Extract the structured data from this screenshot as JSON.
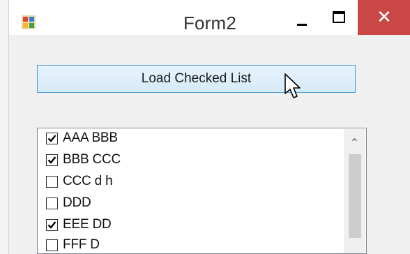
{
  "window": {
    "title": "Form2",
    "close_glyph": "✕"
  },
  "toolbar": {
    "load_label": "Load Checked List"
  },
  "list": {
    "items": [
      {
        "label": "AAA BBB",
        "checked": true
      },
      {
        "label": "BBB CCC",
        "checked": true
      },
      {
        "label": "CCC d h",
        "checked": false
      },
      {
        "label": "DDD",
        "checked": false
      },
      {
        "label": "EEE DD",
        "checked": true
      },
      {
        "label": "FFF D",
        "checked": false
      }
    ],
    "scroll_up_glyph": "⌃"
  },
  "colors": {
    "close_button": "#c94747",
    "button_border": "#4a9cd4"
  }
}
